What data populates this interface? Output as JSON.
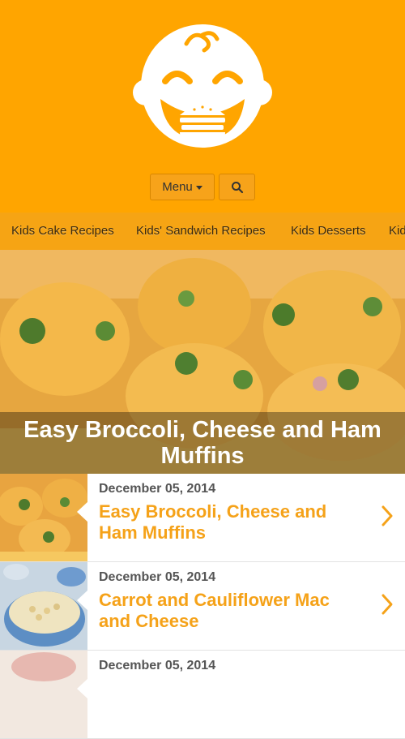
{
  "header": {
    "logo_icon": "baby-burger-logo-icon",
    "menu_label": "Menu",
    "search_icon": "search-icon",
    "bg_color": "#FFA500"
  },
  "categories": [
    "Kids Cake Recipes",
    "Kids' Sandwich Recipes",
    "Kids Desserts",
    "Kid"
  ],
  "featured": {
    "title": "Easy Broccoli, Cheese and Ham Muffins"
  },
  "posts": [
    {
      "date": "December 05, 2014",
      "title": "Easy Broccoli, Cheese and Ham Muffins"
    },
    {
      "date": "December 05, 2014",
      "title": "Carrot and Cauliflower Mac and Cheese"
    },
    {
      "date": "December 05, 2014",
      "title": ""
    }
  ],
  "accent_color": "#F5A219"
}
